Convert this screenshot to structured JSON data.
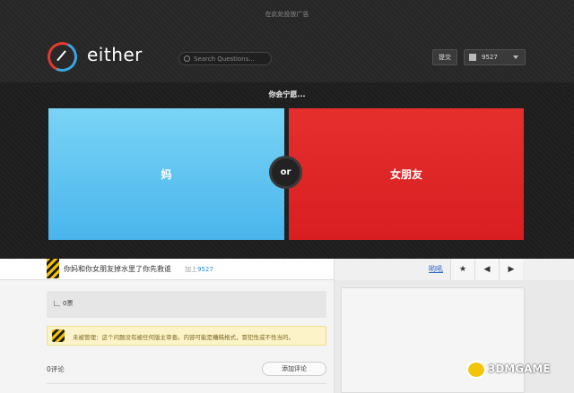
{
  "ad": {
    "text": "在此处投放广告"
  },
  "header": {
    "logo_text": "either",
    "search_placeholder": "Search Questions...",
    "submit_label": "提交",
    "username": "9527"
  },
  "question": {
    "prompt": "你会宁愿...",
    "option_a": "妈",
    "option_b": "女朋友",
    "or_label": "or",
    "full_text": "你妈和你女朋友掉水里了你先救谁",
    "added_prefix": "加上",
    "added_user": "9527"
  },
  "toolbar": {
    "share_link": "哟吼"
  },
  "stats": {
    "votes": "0票"
  },
  "notice": {
    "text": "未被管理：这个问题没有被任何版主审查。内容可能是糟糕格式，冒犯性或不性当的。"
  },
  "comments": {
    "count": "0评论",
    "add_label": "添加评论"
  },
  "watermark": {
    "text": "3DMGAME"
  },
  "colors": {
    "option_a": "#5bbfee",
    "option_b": "#df2728",
    "accent": "#2b8fd1"
  }
}
